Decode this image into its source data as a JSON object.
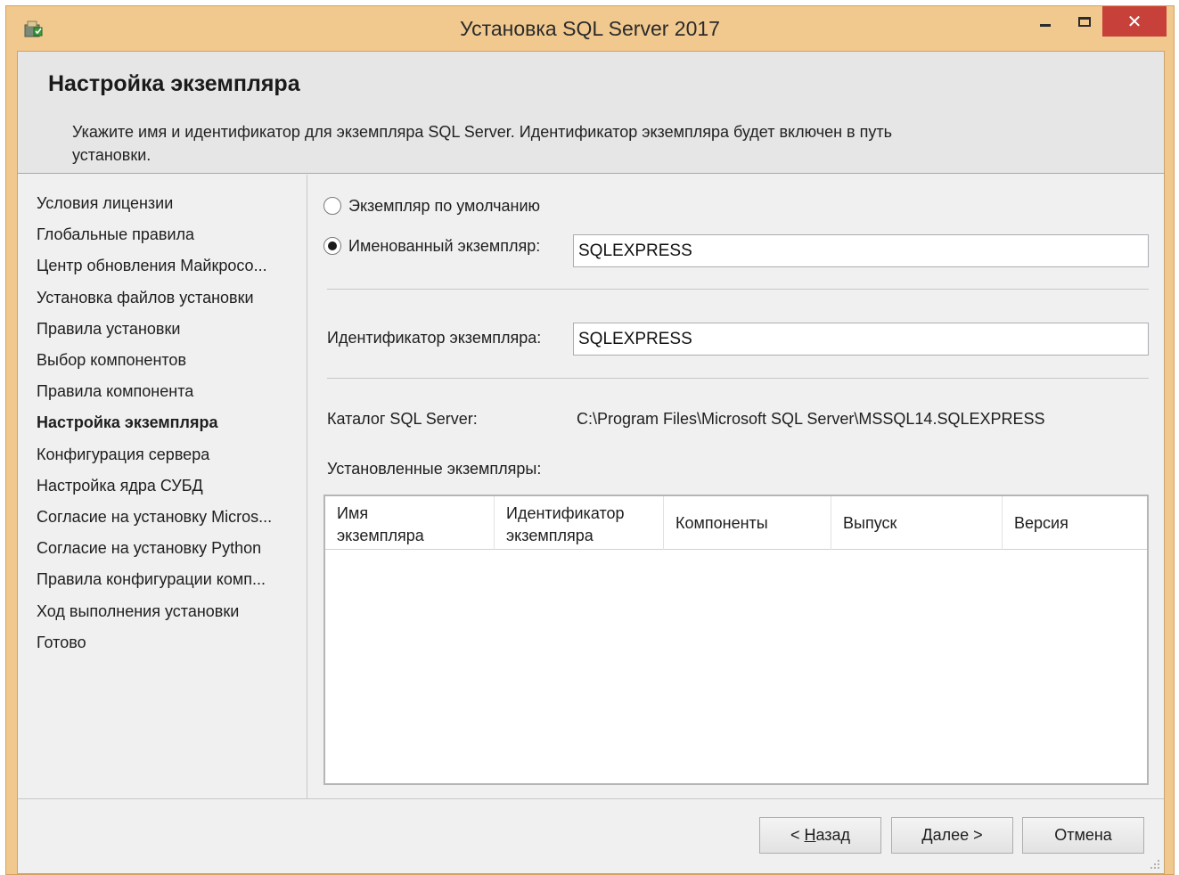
{
  "window": {
    "title": "Установка SQL Server 2017",
    "close_glyph": "✕",
    "accent_color": "#f1c98f",
    "close_color": "#c7413a"
  },
  "header": {
    "title": "Настройка экземпляра",
    "description": "Укажите имя и идентификатор для экземпляра SQL Server. Идентификатор экземпляра будет включен в путь установки."
  },
  "sidebar": {
    "items": [
      {
        "label": "Условия лицензии",
        "active": false
      },
      {
        "label": "Глобальные правила",
        "active": false
      },
      {
        "label": "Центр обновления Майкросо...",
        "active": false
      },
      {
        "label": "Установка файлов установки",
        "active": false
      },
      {
        "label": "Правила установки",
        "active": false
      },
      {
        "label": "Выбор компонентов",
        "active": false
      },
      {
        "label": "Правила компонента",
        "active": false
      },
      {
        "label": "Настройка экземпляра",
        "active": true
      },
      {
        "label": "Конфигурация сервера",
        "active": false
      },
      {
        "label": "Настройка ядра СУБД",
        "active": false
      },
      {
        "label": "Согласие на установку Micros...",
        "active": false
      },
      {
        "label": "Согласие на установку Python",
        "active": false
      },
      {
        "label": "Правила конфигурации комп...",
        "active": false
      },
      {
        "label": "Ход выполнения установки",
        "active": false
      },
      {
        "label": "Готово",
        "active": false
      }
    ]
  },
  "form": {
    "default_instance_label": "Экземпляр по умолчанию",
    "named_instance_label": "Именованный экземпляр:",
    "named_instance_value": "SQLEXPRESS",
    "instance_id_label": "Идентификатор экземпляра:",
    "instance_id_value": "SQLEXPRESS",
    "catalog_label": "Каталог SQL Server:",
    "catalog_value": "C:\\Program Files\\Microsoft SQL Server\\MSSQL14.SQLEXPRESS",
    "installed_label": "Установленные экземпляры:"
  },
  "installed_table": {
    "columns": [
      {
        "line1": "Имя",
        "line2": "экземпляра"
      },
      {
        "line1": "Идентификатор",
        "line2": "экземпляра"
      },
      {
        "line1": "Компоненты",
        "line2": ""
      },
      {
        "line1": "Выпуск",
        "line2": ""
      },
      {
        "line1": "Версия",
        "line2": ""
      }
    ],
    "rows": []
  },
  "buttons": {
    "back": {
      "prefix": "< ",
      "mnemonic": "Н",
      "rest": "азад"
    },
    "next": {
      "prefix": "",
      "mnemonic": "Д",
      "rest": "алее >"
    },
    "cancel": "Отмена"
  }
}
